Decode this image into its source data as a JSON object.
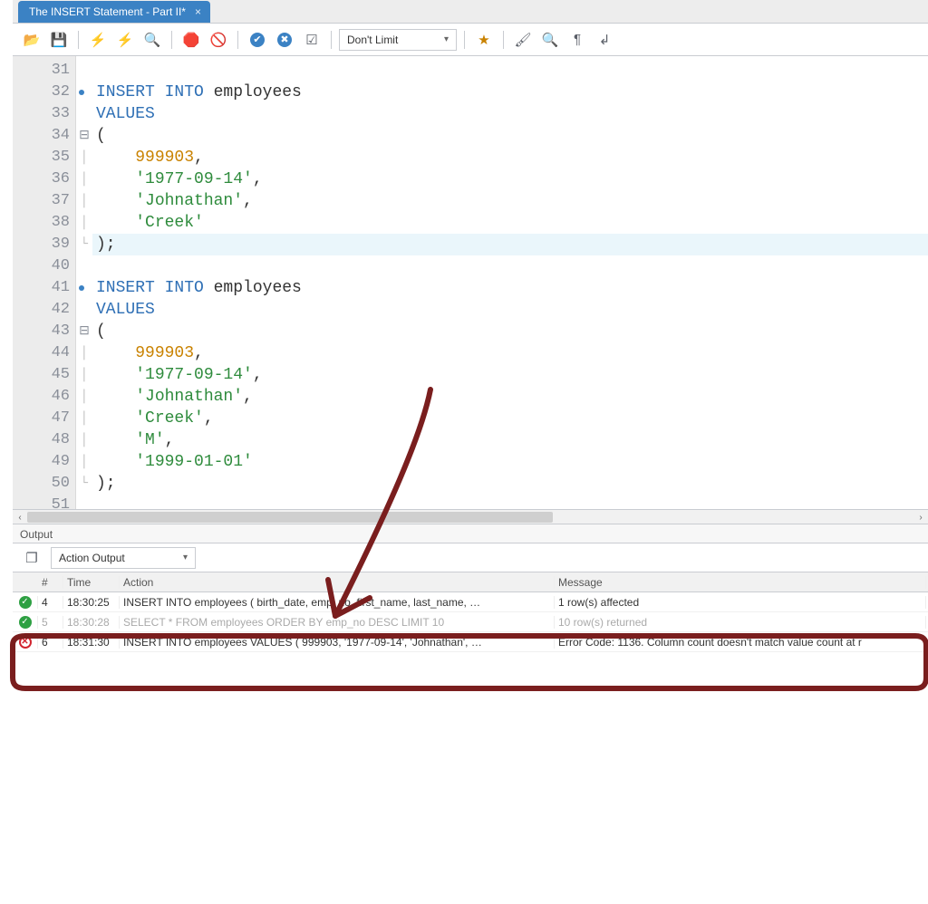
{
  "tab": {
    "title": "The INSERT Statement - Part II*",
    "close": "×"
  },
  "toolbar": {
    "open": "📂",
    "save": "💾",
    "run": "⚡",
    "run_current": "⚡",
    "explain": "🔍",
    "stop": "🛑",
    "stop_all": "🚫",
    "commit": "✔",
    "rollback": "✖",
    "autocommit": "☑",
    "limit_label": "Don't Limit",
    "beautify": "★",
    "find": "🖌",
    "search": "🔍",
    "invisible": "¶",
    "wrap": "↲"
  },
  "editor": {
    "lines": [
      {
        "n": 31,
        "stmt": false,
        "fold": "",
        "html": ""
      },
      {
        "n": 32,
        "stmt": true,
        "fold": "",
        "html": "<span class='kw'>INSERT INTO</span> employees"
      },
      {
        "n": 33,
        "stmt": false,
        "fold": "",
        "html": "<span class='kw'>VALUES</span>"
      },
      {
        "n": 34,
        "stmt": false,
        "fold": "box",
        "html": "<span class='punct'>(</span>"
      },
      {
        "n": 35,
        "stmt": false,
        "fold": "bar",
        "html": "    <span class='num'>999903</span><span class='punct'>,</span>"
      },
      {
        "n": 36,
        "stmt": false,
        "fold": "bar",
        "html": "    <span class='str'>'1977-09-14'</span><span class='punct'>,</span>"
      },
      {
        "n": 37,
        "stmt": false,
        "fold": "bar",
        "html": "    <span class='str'>'Johnathan'</span><span class='punct'>,</span>"
      },
      {
        "n": 38,
        "stmt": false,
        "fold": "bar",
        "html": "    <span class='str'>'Creek'</span>"
      },
      {
        "n": 39,
        "stmt": false,
        "fold": "end",
        "html": "<span class='punct'>);</span>",
        "current": true
      },
      {
        "n": 40,
        "stmt": false,
        "fold": "",
        "html": ""
      },
      {
        "n": 41,
        "stmt": true,
        "fold": "",
        "html": "<span class='kw'>INSERT INTO</span> employees"
      },
      {
        "n": 42,
        "stmt": false,
        "fold": "",
        "html": "<span class='kw'>VALUES</span>"
      },
      {
        "n": 43,
        "stmt": false,
        "fold": "box",
        "html": "<span class='punct'>(</span>"
      },
      {
        "n": 44,
        "stmt": false,
        "fold": "bar",
        "html": "    <span class='num'>999903</span><span class='punct'>,</span>"
      },
      {
        "n": 45,
        "stmt": false,
        "fold": "bar",
        "html": "    <span class='str'>'1977-09-14'</span><span class='punct'>,</span>"
      },
      {
        "n": 46,
        "stmt": false,
        "fold": "bar",
        "html": "    <span class='str'>'Johnathan'</span><span class='punct'>,</span>"
      },
      {
        "n": 47,
        "stmt": false,
        "fold": "bar",
        "html": "    <span class='str'>'Creek'</span><span class='punct'>,</span>"
      },
      {
        "n": 48,
        "stmt": false,
        "fold": "bar",
        "html": "    <span class='str'>'M'</span><span class='punct'>,</span>"
      },
      {
        "n": 49,
        "stmt": false,
        "fold": "bar",
        "html": "    <span class='str'>'1999-01-01'</span>"
      },
      {
        "n": 50,
        "stmt": false,
        "fold": "end",
        "html": "<span class='punct'>);</span>"
      },
      {
        "n": 51,
        "stmt": false,
        "fold": "",
        "html": ""
      }
    ]
  },
  "output": {
    "panel_label": "Output",
    "selector": "Action Output",
    "columns": {
      "num": "#",
      "time": "Time",
      "action": "Action",
      "message": "Message"
    },
    "rows": [
      {
        "status": "ok",
        "num": "4",
        "time": "18:30:25",
        "action": "INSERT INTO employees ( birth_date,    emp_no,    first_name,    last_name,   …",
        "message": "1 row(s) affected"
      },
      {
        "status": "ok",
        "num": "5",
        "time": "18:30:28",
        "faded": true,
        "action": "SELECT  * FROM employees ORDER BY emp_no DESC LIMIT 10",
        "message": "10 row(s) returned"
      },
      {
        "status": "err",
        "num": "6",
        "time": "18:31:30",
        "action": "INSERT INTO employees VALUES ( 999903,    '1977-09-14',    'Johnathan',   …",
        "message": "Error Code: 1136. Column count doesn't match value count at r"
      }
    ]
  },
  "colors": {
    "keyword": "#2E6FB5",
    "number": "#C98200",
    "string": "#2E8B3C",
    "ok": "#2EA043",
    "error": "#D1242F",
    "annotation": "#7A1E1E"
  }
}
